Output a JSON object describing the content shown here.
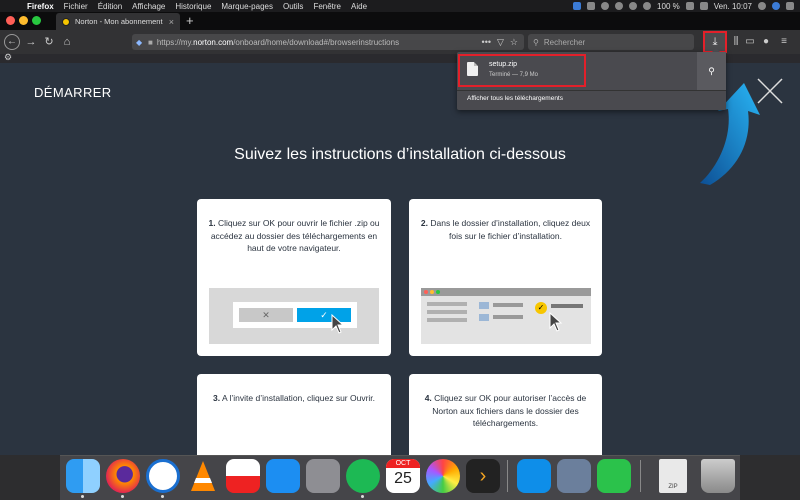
{
  "menubar": {
    "app": "Firefox",
    "items": [
      "Fichier",
      "Édition",
      "Affichage",
      "Historique",
      "Marque-pages",
      "Outils",
      "Fenêtre",
      "Aide"
    ],
    "battery": "100 %",
    "clock": "Ven. 10:07"
  },
  "tab": {
    "title": "Norton - Mon abonnement",
    "close": "×",
    "new": "+"
  },
  "nav": {
    "url_prefix": "https://my.",
    "url_host": "norton.com",
    "url_path": "/onboard/home/download#/browserinstructions",
    "search_placeholder": "Rechercher"
  },
  "page": {
    "title": "DÉMARRER",
    "headline": "Suivez les instructions d’installation ci-dessous",
    "cards": [
      {
        "num": "1.",
        "text": " Cliquez sur OK pour ouvrir le fichier .zip ou accédez au dossier des téléchargements en haut de votre navigateur."
      },
      {
        "num": "2.",
        "text": " Dans le dossier d’installation, cliquez deux fois sur le fichier d’installation."
      },
      {
        "num": "3.",
        "text": " A l’invite d’installation, cliquez sur Ouvrir."
      },
      {
        "num": "4.",
        "text": " Cliquez sur OK pour autoriser l’accès de Norton aux fichiers dans le dossier des téléchargements."
      }
    ]
  },
  "downloads": {
    "file": "setup.zip",
    "status": "Terminé — 7,9 Mo",
    "show_all": "Afficher tous les téléchargements"
  },
  "dock": {
    "zip_label": "ZIP",
    "calendar_month": "OCT",
    "calendar_day": "25"
  },
  "colors": {
    "highlight": "#e3202a",
    "accent": "#00a2e8",
    "page_bg": "#2b3440"
  }
}
